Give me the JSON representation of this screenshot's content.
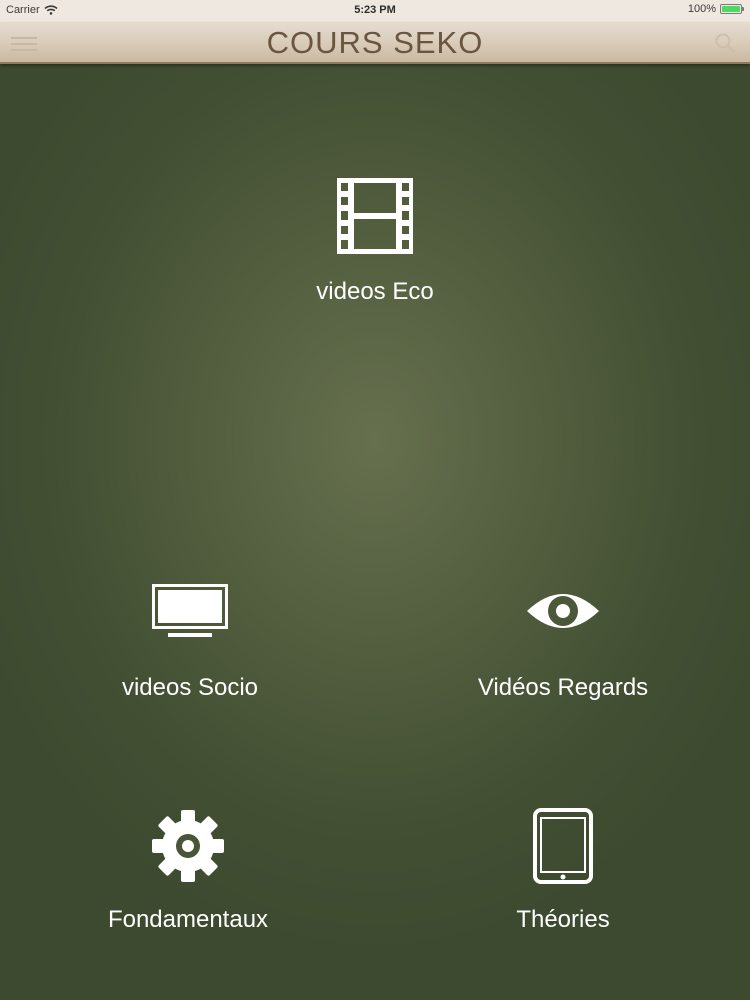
{
  "status_bar": {
    "carrier": "Carrier",
    "time": "5:23 PM",
    "battery": "100%",
    "battery_level": 1.0,
    "battery_color": "#4cd964",
    "icons": [
      "wifi-icon",
      "battery-icon"
    ]
  },
  "nav": {
    "title": "COURS SEKO",
    "title_color": "#6a5640",
    "left_icon": "menu-icon",
    "right_icon": "search-icon"
  },
  "background_color": "#4a5638",
  "tiles": [
    {
      "label": "videos Eco",
      "icon": "film-icon"
    },
    {
      "label": "videos Socio",
      "icon": "tv-icon"
    },
    {
      "label": "Vidéos Regards",
      "icon": "eye-icon"
    },
    {
      "label": "Fondamentaux",
      "icon": "gear-icon"
    },
    {
      "label": "Théories",
      "icon": "tablet-icon"
    }
  ]
}
